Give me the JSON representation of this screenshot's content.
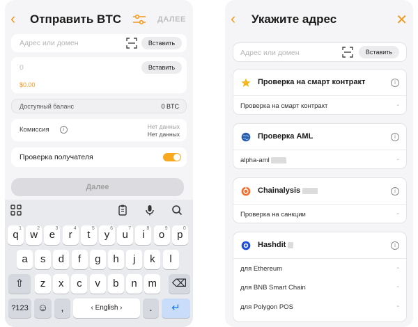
{
  "left": {
    "title": "Отправить BTC",
    "next_label": "ДАЛЕЕ",
    "address": {
      "placeholder": "Адрес или домен",
      "paste_label": "Вставить"
    },
    "amount": {
      "value": "0",
      "paste_label": "Вставить",
      "fiat_value": "$0.00"
    },
    "balance": {
      "label": "Доступный баланс",
      "value": "0 BTC"
    },
    "fee": {
      "label": "Комиссия",
      "no_data_1": "Нет данных",
      "no_data_2": "Нет данных"
    },
    "check_recipient": {
      "label": "Проверка получателя",
      "enabled": true
    },
    "submit_label": "Далее",
    "keyboard": {
      "row1": [
        {
          "k": "q",
          "s": "1"
        },
        {
          "k": "w",
          "s": "2"
        },
        {
          "k": "e",
          "s": "3"
        },
        {
          "k": "r",
          "s": "4"
        },
        {
          "k": "t",
          "s": "5"
        },
        {
          "k": "y",
          "s": "6"
        },
        {
          "k": "u",
          "s": "7"
        },
        {
          "k": "i",
          "s": "8"
        },
        {
          "k": "o",
          "s": "9"
        },
        {
          "k": "p",
          "s": "0"
        }
      ],
      "row2": [
        "a",
        "s",
        "d",
        "f",
        "g",
        "h",
        "j",
        "k",
        "l"
      ],
      "row3": [
        "z",
        "x",
        "c",
        "v",
        "b",
        "n",
        "m"
      ],
      "shift": "⇧",
      "backspace": "⌫",
      "numbers": "?123",
      "emoji": "☺",
      "comma": ",",
      "space": "‹ English ›",
      "period": ".",
      "enter": "↵"
    }
  },
  "right": {
    "title": "Укажите адрес",
    "address": {
      "placeholder": "Адрес или домен",
      "paste_label": "Вставить"
    },
    "sections": [
      {
        "title": "Проверка на смарт контракт",
        "icon": "star-icon",
        "rows": [
          {
            "label": "Проверка на смарт контракт",
            "value": "-"
          }
        ]
      },
      {
        "title": "Проверка AML",
        "icon": "globe-icon",
        "rows": [
          {
            "label": "alpha-aml",
            "value": "-"
          }
        ]
      },
      {
        "title": "Chainalysis",
        "icon": "chainalysis-icon",
        "rows": [
          {
            "label": "Проверка на санкции",
            "value": "-"
          }
        ]
      },
      {
        "title": "Hashdit",
        "icon": "hashdit-icon",
        "rows": [
          {
            "label": "для Ethereum",
            "value": "-"
          },
          {
            "label": "для BNB Smart Chain",
            "value": "-"
          },
          {
            "label": "для Polygon POS",
            "value": "-"
          }
        ]
      }
    ]
  },
  "colors": {
    "accent": "#f39a1d",
    "toggle": "#f7a920",
    "screen_bg": "#f5f5f7",
    "enter_key": "#c9dcfa"
  }
}
